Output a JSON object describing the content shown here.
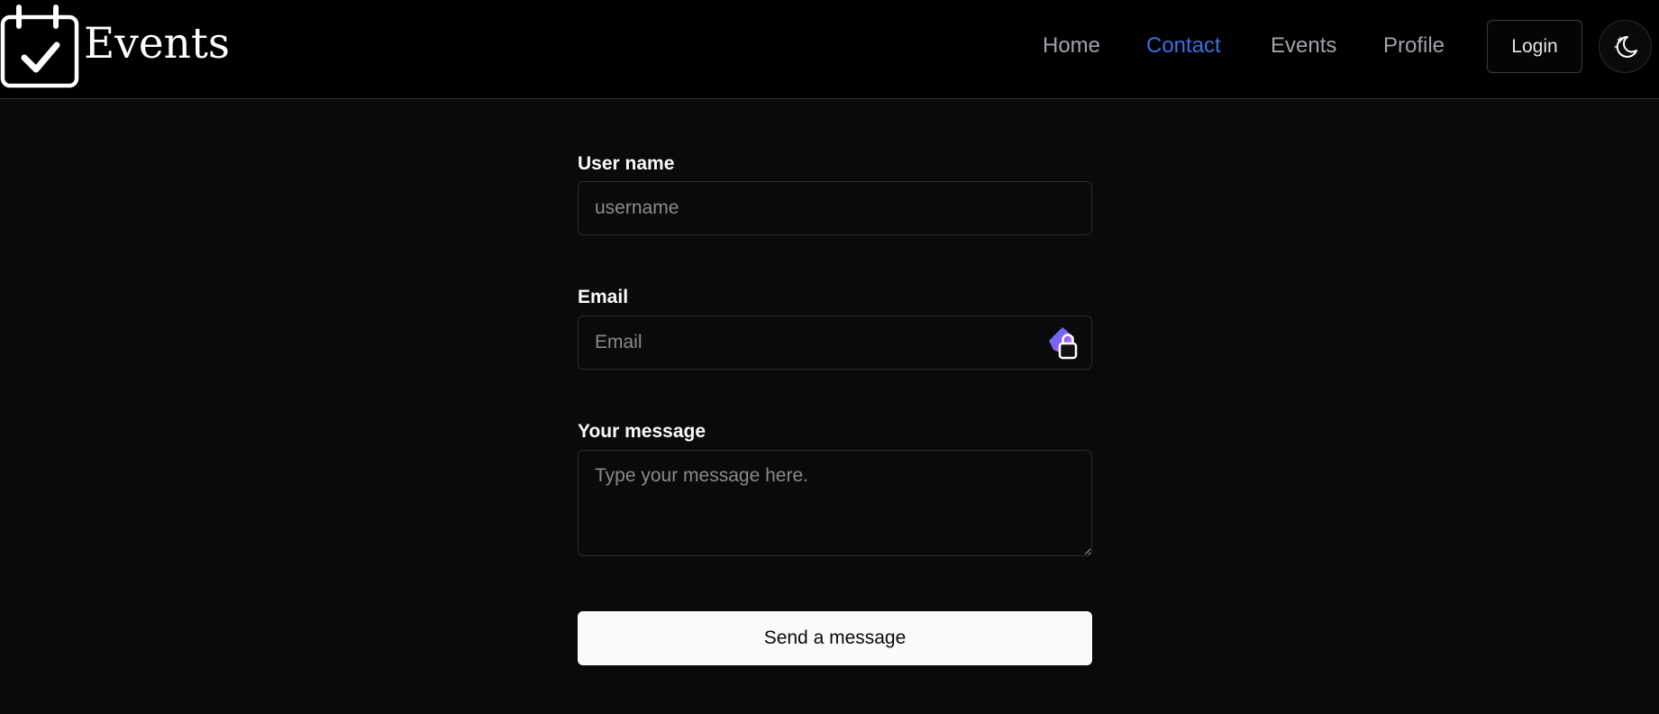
{
  "header": {
    "brand_title": "Events",
    "brand_icon": "calendar-check-icon",
    "nav": {
      "home": "Home",
      "contact": "Contact",
      "events": "Events",
      "profile": "Profile"
    },
    "active_nav": "contact",
    "login_label": "Login",
    "theme_icon": "moon-stars-icon"
  },
  "form": {
    "username": {
      "label": "User name",
      "placeholder": "username",
      "value": ""
    },
    "email": {
      "label": "Email",
      "placeholder": "Email",
      "value": ""
    },
    "message": {
      "label": "Your message",
      "placeholder": "Type your message here.",
      "value": ""
    },
    "submit_label": "Send a message"
  },
  "colors": {
    "page_background": "#0a0a0a",
    "header_background": "#000000",
    "active_link": "#3b6fe0",
    "nav_link": "#a1a1aa",
    "button_background": "#fafafa"
  }
}
